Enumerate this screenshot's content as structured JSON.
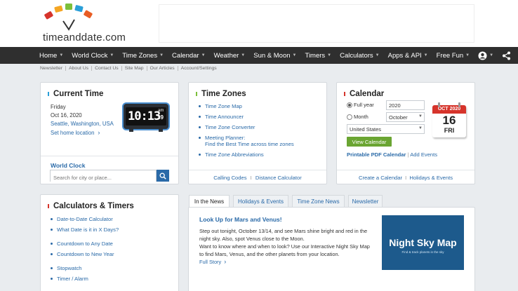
{
  "logo": {
    "text": "timeanddate.com"
  },
  "nav": {
    "items": [
      {
        "label": "Home"
      },
      {
        "label": "World Clock"
      },
      {
        "label": "Time Zones"
      },
      {
        "label": "Calendar"
      },
      {
        "label": "Weather"
      },
      {
        "label": "Sun & Moon"
      },
      {
        "label": "Timers"
      },
      {
        "label": "Calculators"
      },
      {
        "label": "Apps & API"
      },
      {
        "label": "Free Fun"
      }
    ],
    "icons": [
      "user-icon",
      "share-icon",
      "search-icon"
    ]
  },
  "subnav": [
    "Newsletter",
    "About Us",
    "Contact Us",
    "Site Map",
    "Our Articles",
    "Account/Settings"
  ],
  "current_time": {
    "title": "Current Time",
    "day": "Friday",
    "date": "Oct 16, 2020",
    "location": "Seattle, Washington, USA",
    "set_home": "Set home location",
    "clock_time": "10:13",
    "clock_ampm": "am",
    "clock_seconds": "39",
    "world_clock_label": "World Clock",
    "search_placeholder": "Search for city or place..."
  },
  "time_zones": {
    "title": "Time Zones",
    "links": [
      "Time Zone Map",
      "Time Announcer",
      "Time Zone Converter",
      "Meeting Planner:",
      "Time Zone Abbreviations"
    ],
    "meeting_sub": "Find the Best Time across time zones",
    "footer_left": "Calling Codes",
    "footer_sep": "I",
    "footer_right": "Distance Calculator"
  },
  "calendar": {
    "title": "Calendar",
    "full_year_label": "Full year",
    "year_value": "2020",
    "month_label": "Month",
    "month_value": "October",
    "country_value": "United States",
    "view_button": "View Calendar",
    "printable": "Printable PDF Calendar",
    "add_events": "Add Events",
    "icon_month": "OCT 2020",
    "icon_day": "16",
    "icon_weekday": "FRI",
    "footer_left": "Create a Calendar",
    "footer_sep": "I",
    "footer_right": "Holidays & Events"
  },
  "calculators": {
    "title": "Calculators & Timers",
    "links": [
      "Date-to-Date Calculator",
      "What Date is it in X Days?",
      "Countdown to Any Date",
      "Countdown to New Year",
      "Stopwatch",
      "Timer / Alarm"
    ]
  },
  "news": {
    "tabs": [
      "In the News",
      "Holidays & Events",
      "Time Zone News",
      "Newsletter"
    ],
    "headline": "Look Up for Mars and Venus!",
    "body1": "Step out tonight, October 13/14, and see Mars shine bright and red in the night sky. Also, spot Venus close to the Moon.",
    "body2": "Want to know where and when to look? Use our Interactive Night Sky Map to find Mars, Venus, and the other planets from your location.",
    "full_story": "Full Story",
    "image_title": "Night Sky Map",
    "image_subtitle": "Find & track planets in the sky"
  },
  "colors": {
    "accent_blue": "#2a6aa8",
    "nav_bg": "#2f2f2f",
    "button_green": "#6aa532",
    "calendar_red": "#d6342b"
  }
}
